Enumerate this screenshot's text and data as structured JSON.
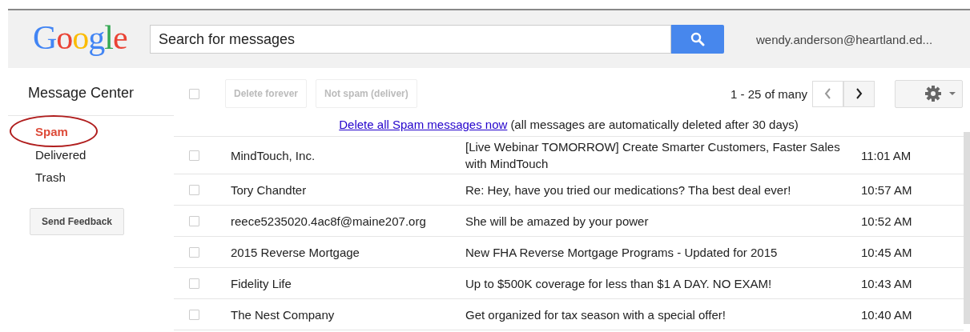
{
  "header": {
    "logo": "Google",
    "search": {
      "placeholder": "Search for messages"
    },
    "account": "wendy.anderson@heartland.ed..."
  },
  "sidebar": {
    "title": "Message Center",
    "items": [
      {
        "label": "Spam",
        "selected": true,
        "circled": true
      },
      {
        "label": "Delivered",
        "selected": false,
        "circled": false
      },
      {
        "label": "Trash",
        "selected": false,
        "circled": false
      }
    ],
    "feedback_button": "Send Feedback"
  },
  "toolbar": {
    "select_all": {
      "checked": false
    },
    "buttons": [
      {
        "label": "Delete forever",
        "disabled": true
      },
      {
        "label": "Not spam (deliver)",
        "disabled": true
      }
    ],
    "pagination": "1 - 25 of many",
    "prev": {
      "disabled": true
    },
    "next": {
      "disabled": false
    }
  },
  "notice": {
    "link": "Delete all Spam messages now",
    "text": "(all messages are automatically deleted after 30 days)"
  },
  "messages": [
    {
      "checked": false,
      "sender": "MindTouch, Inc.",
      "subject": "[Live Webinar TOMORROW] Create Smarter Customers, Faster Sales with MindTouch",
      "time": "11:01 AM"
    },
    {
      "checked": false,
      "sender": "Tory Chandter",
      "subject": "Re: Hey, have you tried our medications? Tha best deal ever!",
      "time": "10:57 AM"
    },
    {
      "checked": false,
      "sender": "reece5235020.4ac8f@maine207.org",
      "subject": "She will be amazed by your power",
      "time": "10:52 AM"
    },
    {
      "checked": false,
      "sender": "2015 Reverse Mortgage",
      "subject": "New FHA Reverse Mortgage Programs - Updated for 2015",
      "time": "10:45 AM"
    },
    {
      "checked": false,
      "sender": "Fidelity Life",
      "subject": "Up to $500K coverage for less than $1 A DAY. NO EXAM!",
      "time": "10:43 AM"
    },
    {
      "checked": false,
      "sender": "The Nest Company",
      "subject": "Get organized for tax season with a special offer!",
      "time": "10:40 AM"
    }
  ]
}
